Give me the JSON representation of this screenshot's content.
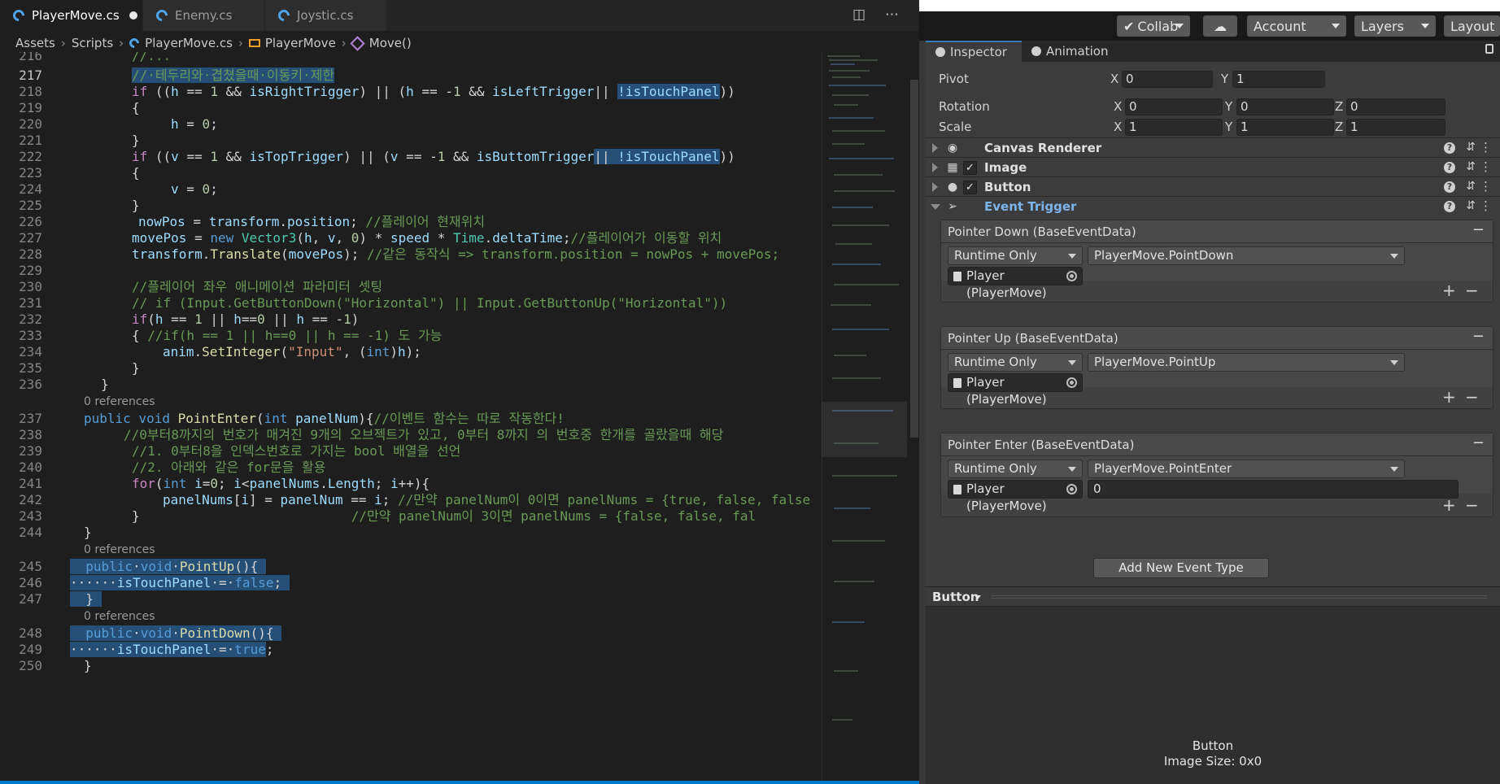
{
  "editor": {
    "tabs": [
      {
        "label": "PlayerMove.cs",
        "dirty": true
      },
      {
        "label": "Enemy.cs"
      },
      {
        "label": "Joystic.cs"
      }
    ],
    "breadcrumb": [
      "Assets",
      "Scripts",
      "PlayerMove.cs",
      "PlayerMove",
      "Move()"
    ],
    "codelens": "0 references",
    "line_numbers": [
      "216",
      "217",
      "218",
      "219",
      "220",
      "221",
      "222",
      "223",
      "224",
      "225",
      "226",
      "227",
      "228",
      "229",
      "230",
      "231",
      "232",
      "233",
      "234",
      "235",
      "236",
      "237",
      "238",
      "239",
      "240",
      "241",
      "242",
      "243",
      "244",
      "245",
      "246",
      "247",
      "248",
      "249",
      "250"
    ]
  },
  "unity": {
    "toolbar": {
      "collab": "Collab",
      "account": "Account",
      "layers": "Layers",
      "layout": "Layout"
    },
    "tabs": {
      "inspector": "Inspector",
      "animation": "Animation"
    },
    "transform": {
      "pivot_label": "Pivot",
      "pivot_x": "0",
      "pivot_y": "1",
      "rotation_label": "Rotation",
      "rot_x": "0",
      "rot_y": "0",
      "rot_z": "0",
      "scale_label": "Scale",
      "scale_x": "1",
      "scale_y": "1",
      "scale_z": "1",
      "axis_x": "X",
      "axis_y": "Y",
      "axis_z": "Z"
    },
    "components": {
      "canvas_renderer": "Canvas Renderer",
      "image": "Image",
      "button": "Button",
      "event_trigger": "Event Trigger"
    },
    "events": [
      {
        "title": "Pointer Down (BaseEventData)",
        "mode": "Runtime Only",
        "function": "PlayerMove.PointDown",
        "target": "Player (PlayerMove)"
      },
      {
        "title": "Pointer Up (BaseEventData)",
        "mode": "Runtime Only",
        "function": "PlayerMove.PointUp",
        "target": "Player (PlayerMove)"
      },
      {
        "title": "Pointer Enter (BaseEventData)",
        "mode": "Runtime Only",
        "function": "PlayerMove.PointEnter",
        "target": "Player (PlayerMove)",
        "argument": "0"
      }
    ],
    "add_event_label": "Add New Event Type",
    "preview": {
      "label": "Button",
      "name": "Button",
      "size": "Image Size: 0x0"
    }
  }
}
